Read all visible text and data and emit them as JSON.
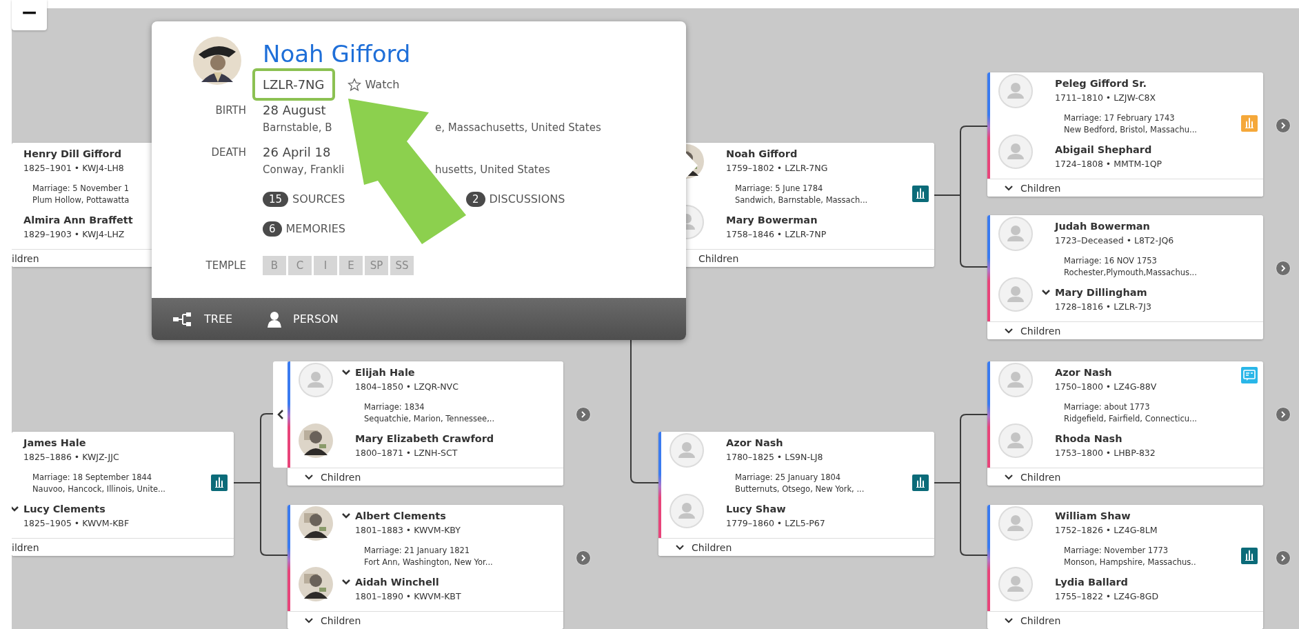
{
  "zoom_out_button": "−",
  "popup": {
    "name": "Noah Gifford",
    "photo": true,
    "id": "LZLR-7NG",
    "id_highlighted": true,
    "watch": "Watch",
    "facts": [
      {
        "label": "BIRTH",
        "date": "28 August",
        "place_parts": [
          "Barnstable, B",
          "e, Massachusetts, United States"
        ]
      },
      {
        "label": "DEATH",
        "date": "26 April 18",
        "place_parts": [
          "Conway, Frankli",
          "husetts, United States"
        ]
      }
    ],
    "counts": [
      {
        "count": "15",
        "label": "SOURCES"
      },
      {
        "count": "2",
        "label": "DISCUSSIONS"
      },
      {
        "count": "6",
        "label": "MEMORIES"
      }
    ],
    "temple_label": "TEMPLE",
    "temple": [
      "B",
      "C",
      "I",
      "E",
      "SP",
      "SS"
    ],
    "footer": [
      {
        "kind": "tree",
        "label": "TREE"
      },
      {
        "kind": "person",
        "label": "PERSON"
      }
    ]
  },
  "cards": [
    {
      "kind": "clipped",
      "husband": {
        "name": "Henry Dill Gifford",
        "life": "1825–1901 • KWJ4-LH8",
        "chevron": false
      },
      "marriage": "Marriage: 5 November 1",
      "place": "Plum Hollow, Pottawatta",
      "wife": {
        "name": "Almira Ann Braffett",
        "life": "1829–1903 • KWJ4-LHZ",
        "chevron": false
      },
      "children": "ildren",
      "children_chevron": false,
      "expand": false
    },
    {
      "kind": "clipped",
      "husband": {
        "name": "James Hale",
        "life": "1825–1886 • KWJZ-JJC",
        "chevron": false
      },
      "marriage": "Marriage: 18 September 1844",
      "place": "Nauvoo, Hancock, Illinois, Unite...",
      "wife": {
        "name": "Lucy Clements",
        "life": "1825–1905 • KWVM-KBF",
        "chevron": true
      },
      "badge": {
        "kind": "temple",
        "color": "#0b6b79"
      },
      "children": "ildren",
      "children_chevron": false,
      "expand": false
    },
    {
      "kind": "full",
      "back_chevron": true,
      "husband": {
        "name": "Elijah Hale",
        "life": "1804–1850 • LZQR-NVC",
        "chevron": true,
        "photo": false
      },
      "marriage": "Marriage: 1834",
      "place": "Sequatchie, Marion, Tennessee,..",
      "wife": {
        "name": "Mary Elizabeth Crawford",
        "life": "1800–1871 • LZNH-SCT",
        "chevron": false,
        "photo": true
      },
      "children": "Children",
      "children_chevron": true,
      "expand": true
    },
    {
      "kind": "full",
      "back_chevron": false,
      "husband": {
        "name": "Albert Clements",
        "life": "1801–1883 • KWVM-KBY",
        "chevron": true,
        "photo": true
      },
      "marriage": "Marriage: 21 January 1821",
      "place": "Fort Ann, Washington, New Yor...",
      "wife": {
        "name": "Aidah Winchell",
        "life": "1801–1890 • KWVM-KBT",
        "chevron": true,
        "photo": true
      },
      "children": "Children",
      "children_chevron": true,
      "expand": true
    },
    {
      "kind": "full",
      "back_chevron": false,
      "husband": {
        "name": "Noah Gifford",
        "life": "1759–1802 • LZLR-7NG",
        "chevron": false,
        "photo": true
      },
      "marriage": "Marriage: 5 June 1784",
      "place": "Sandwich, Barnstable, Massach...",
      "wife": {
        "name": "Mary Bowerman",
        "life": "1758–1846 • LZLR-7NP",
        "chevron": false,
        "photo": false
      },
      "badge": {
        "kind": "temple",
        "color": "#0b6b79"
      },
      "children": "Children",
      "children_chevron": false,
      "expand": false
    },
    {
      "kind": "full",
      "back_chevron": false,
      "husband": {
        "name": "Azor Nash",
        "life": "1780–1825 • LS9N-LJ8",
        "chevron": false,
        "photo": false
      },
      "marriage": "Marriage: 25 January 1804",
      "place": "Butternuts, Otsego, New York, ...",
      "wife": {
        "name": "Lucy Shaw",
        "life": "1779–1860 • LZL5-P67",
        "chevron": false,
        "photo": false
      },
      "badge": {
        "kind": "temple",
        "color": "#0b6b79"
      },
      "children": "Children",
      "children_chevron": true,
      "expand": false
    },
    {
      "kind": "full",
      "back_chevron": false,
      "husband": {
        "name": "Peleg Gifford Sr.",
        "life": "1711–1810 • LZJW-C8X",
        "chevron": false,
        "photo": false
      },
      "marriage": "Marriage: 17 February 1743",
      "place": "New Bedford, Bristol, Massachu...",
      "wife": {
        "name": "Abigail Shephard",
        "life": "1724–1808 • MMTM-1QP",
        "chevron": false,
        "photo": false
      },
      "badge": {
        "kind": "temple",
        "color": "#f5a83a"
      },
      "children": "Children",
      "children_chevron": true,
      "expand": true
    },
    {
      "kind": "full",
      "back_chevron": false,
      "husband": {
        "name": "Judah Bowerman",
        "life": "1723–Deceased • L8T2-JQ6",
        "chevron": false,
        "photo": false
      },
      "marriage": "Marriage: 16 NOV 1753",
      "place": "Rochester,Plymouth,Massachus...",
      "wife": {
        "name": "Mary Dillingham",
        "life": "1728–1816 • LZLR-7J3",
        "chevron": true,
        "photo": false
      },
      "children": "Children",
      "children_chevron": true,
      "expand": true
    },
    {
      "kind": "full",
      "back_chevron": false,
      "husband": {
        "name": "Azor Nash",
        "life": "1750–1800 • LZ4G-88V",
        "chevron": false,
        "photo": false
      },
      "marriage": "Marriage: about 1773",
      "place": "Ridgefield, Fairfield, Connecticu...",
      "wife": {
        "name": "Rhoda Nash",
        "life": "1753–1800 • LHBP-832",
        "chevron": false,
        "photo": false
      },
      "badge": {
        "kind": "record",
        "color": "#29b6e8"
      },
      "children": "Children",
      "children_chevron": true,
      "expand": true
    },
    {
      "kind": "full",
      "back_chevron": false,
      "husband": {
        "name": "William Shaw",
        "life": "1752–1826 • LZ4G-8LM",
        "chevron": false,
        "photo": false
      },
      "marriage": "Marriage: November 1773",
      "place": "Monson, Hampshire, Massachus..",
      "wife": {
        "name": "Lydia Ballard",
        "life": "1755–1822 • LZ4G-8GD",
        "chevron": false,
        "photo": false
      },
      "badge": {
        "kind": "temple",
        "color": "#0b6b79"
      },
      "children": "Children",
      "children_chevron": true,
      "expand": true
    }
  ]
}
